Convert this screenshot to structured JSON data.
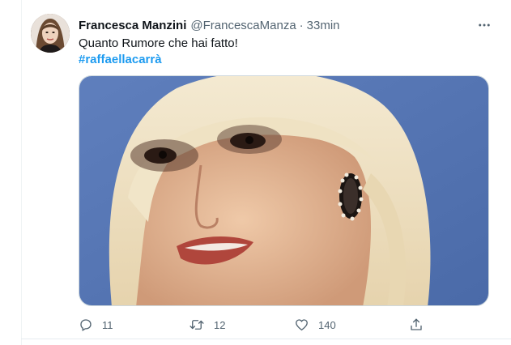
{
  "tweet": {
    "author": {
      "display_name": "Francesca Manzini",
      "handle": "@FrancescaManza",
      "avatar_icon": "profile-photo"
    },
    "separator": "·",
    "time": "33min",
    "text": "Quanto Rumore che hai fatto!",
    "hashtag": "#raffaellacarrà",
    "media": {
      "kind": "photo",
      "description_icon": "portrait-photo"
    },
    "actions": {
      "reply": {
        "icon": "reply-icon",
        "count": "11"
      },
      "retweet": {
        "icon": "retweet-icon",
        "count": "12"
      },
      "like": {
        "icon": "heart-icon",
        "count": "140"
      },
      "share": {
        "icon": "share-icon"
      }
    }
  },
  "colors": {
    "link": "#1d9bf0",
    "secondary_text": "#536471",
    "primary_text": "#0f1419",
    "border": "#cfd9de"
  }
}
